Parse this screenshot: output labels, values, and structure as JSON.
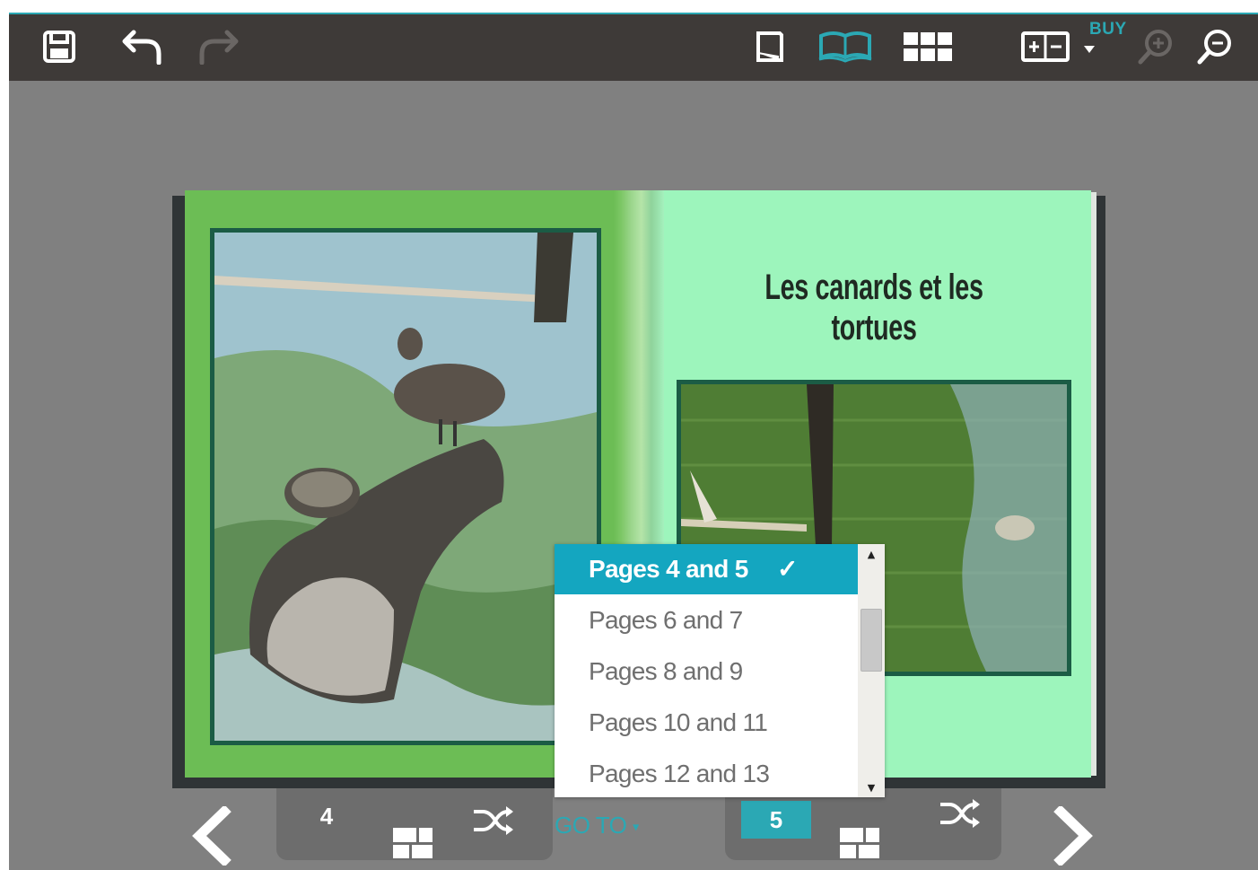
{
  "toolbar": {
    "buy_label": "BUY",
    "icons": [
      "save-icon",
      "undo-icon",
      "redo-icon",
      "single-page-icon",
      "open-book-icon",
      "grid-view-icon",
      "layout-icon",
      "zoom-in-icon",
      "zoom-out-icon"
    ],
    "accent": "#2ba8b4"
  },
  "spread": {
    "title": "Les canards et les tortues",
    "left_photo": "ducks-and-turtle-on-log",
    "right_photo": "pond-with-turtle"
  },
  "bottom_bar": {
    "left_page": "4",
    "right_page": "5",
    "goto_label": "GO TO",
    "goto_caret": "▾"
  },
  "goto_dropdown": {
    "items": [
      {
        "label": "Pages 4 and 5",
        "selected": true
      },
      {
        "label": "Pages 6 and 7",
        "selected": false
      },
      {
        "label": "Pages 8 and 9",
        "selected": false
      },
      {
        "label": "Pages 10 and 11",
        "selected": false
      },
      {
        "label": "Pages 12 and 13",
        "selected": false
      }
    ],
    "check_glyph": "✓",
    "selected_color": "#14a6c0"
  }
}
